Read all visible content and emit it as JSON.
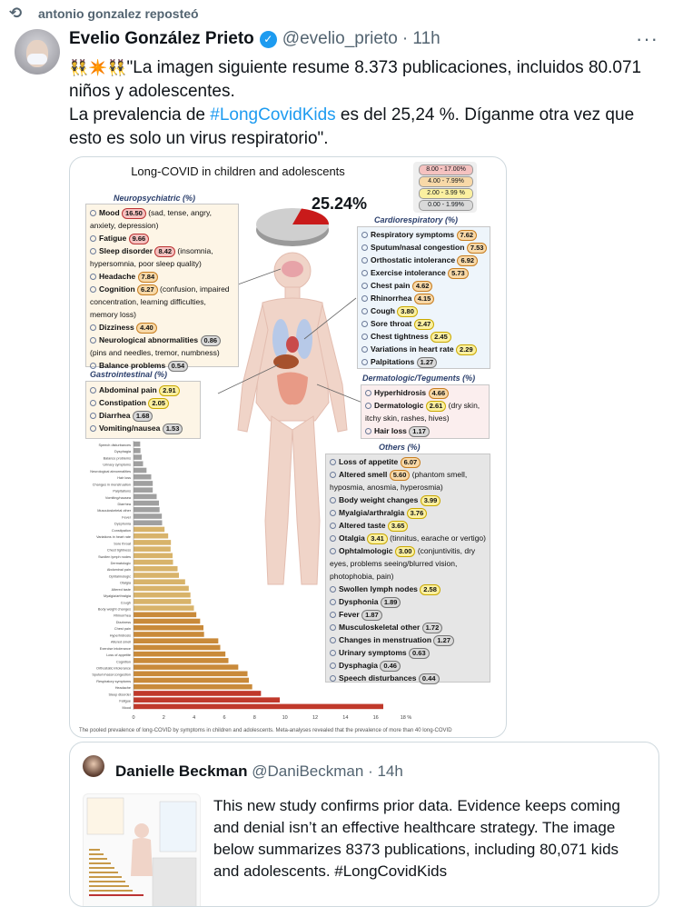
{
  "repost": {
    "text": "antonio gonzalez reposteó",
    "icon": "repost-icon"
  },
  "tweet": {
    "author_name": "Evelio González Prieto",
    "handle": "@evelio_prieto",
    "time": "· 11h",
    "text_quote_open": "\"La imagen siguiente resume 8.373 publicaciones, incluidos 80.071 niños y adolescentes.",
    "text_line2_pre": "La prevalencia de ",
    "hashtag": "#LongCovidKids",
    "text_line2_post": " es del 25,24 %. Díganme otra vez que esto es solo un virus respiratorio\".",
    "emojis": "👯✴️👯"
  },
  "figure": {
    "title": "Long-COVID in children and adolescents",
    "percent": "25.24%",
    "legend": [
      {
        "label": "8.00 - 17.00%",
        "color": "#f5c2c0"
      },
      {
        "label": "4.00 - 7.99%",
        "color": "#f8d9a8"
      },
      {
        "label": "2.00 - 3.99 %",
        "color": "#fbf0a0"
      },
      {
        "label": "0.00 - 1.99%",
        "color": "#d9d9d9"
      }
    ],
    "neuro": {
      "title": "Neuropsychiatric (%)",
      "items": [
        {
          "name": "Mood",
          "value": "16.50",
          "cls": "p-r",
          "note": "(sad, tense, angry,"
        },
        {
          "name": "",
          "value": "",
          "cls": "",
          "note": "anxiety, depression)"
        },
        {
          "name": "Fatigue",
          "value": "9.66",
          "cls": "p-r",
          "note": ""
        },
        {
          "name": "Sleep disorder",
          "value": "8.42",
          "cls": "p-r",
          "note": "(insomnia,"
        },
        {
          "name": "",
          "value": "",
          "cls": "",
          "note": "hypersomnia, poor sleep quality)"
        },
        {
          "name": "Headache",
          "value": "7.84",
          "cls": "p-o",
          "note": ""
        },
        {
          "name": "Cognition",
          "value": "6.27",
          "cls": "p-o",
          "note": "(confusion, impaired"
        },
        {
          "name": "",
          "value": "",
          "cls": "",
          "note": "concentration, learning difficulties,"
        },
        {
          "name": "",
          "value": "",
          "cls": "",
          "note": "memory loss)"
        },
        {
          "name": "Dizziness",
          "value": "4.40",
          "cls": "p-o",
          "note": ""
        },
        {
          "name": "Neurological abnormalities",
          "value": "0.86",
          "cls": "p-g",
          "note": ""
        },
        {
          "name": "",
          "value": "",
          "cls": "",
          "note": "(pins and needles, tremor, numbness)"
        },
        {
          "name": "Balance problems",
          "value": "0.54",
          "cls": "p-g",
          "note": ""
        }
      ]
    },
    "gastro": {
      "title": "Gastrointestinal (%)",
      "items": [
        {
          "name": "Abdominal pain",
          "value": "2.91",
          "cls": "p-y"
        },
        {
          "name": "Constipation",
          "value": "2.05",
          "cls": "p-y"
        },
        {
          "name": "Diarrhea",
          "value": "1.68",
          "cls": "p-g"
        },
        {
          "name": "Vomiting/nausea",
          "value": "1.53",
          "cls": "p-g"
        }
      ]
    },
    "cardio": {
      "title": "Cardiorespiratory (%)",
      "items": [
        {
          "name": "Respiratory symptoms",
          "value": "7.62",
          "cls": "p-o"
        },
        {
          "name": "Sputum/nasal congestion",
          "value": "7.53",
          "cls": "p-o"
        },
        {
          "name": "Orthostatic intolerance",
          "value": "6.92",
          "cls": "p-o"
        },
        {
          "name": "Exercise intolerance",
          "value": "5.73",
          "cls": "p-o"
        },
        {
          "name": "Chest pain",
          "value": "4.62",
          "cls": "p-o"
        },
        {
          "name": "Rhinorrhea",
          "value": "4.15",
          "cls": "p-o"
        },
        {
          "name": "Cough",
          "value": "3.80",
          "cls": "p-y"
        },
        {
          "name": "Sore throat",
          "value": "2.47",
          "cls": "p-y"
        },
        {
          "name": "Chest tightness",
          "value": "2.45",
          "cls": "p-y"
        },
        {
          "name": "Variations in heart rate",
          "value": "2.29",
          "cls": "p-y"
        },
        {
          "name": "Palpitations",
          "value": "1.27",
          "cls": "p-g"
        }
      ]
    },
    "derma": {
      "title": "Dermatologic/Teguments (%)",
      "items": [
        {
          "name": "Hyperhidrosis",
          "value": "4.66",
          "cls": "p-o",
          "note": ""
        },
        {
          "name": "Dermatologic",
          "value": "2.61",
          "cls": "p-y",
          "note": "(dry skin,"
        },
        {
          "name": "",
          "value": "",
          "cls": "",
          "note": "itchy skin, rashes, hives)"
        },
        {
          "name": "Hair loss",
          "value": "1.17",
          "cls": "p-g",
          "note": ""
        }
      ]
    },
    "others": {
      "title": "Others (%)",
      "items": [
        {
          "name": "Loss of appetite",
          "value": "6.07",
          "cls": "p-o",
          "note": ""
        },
        {
          "name": "Altered smell",
          "value": "5.60",
          "cls": "p-o",
          "note": "(phantom smell,"
        },
        {
          "name": "",
          "value": "",
          "cls": "",
          "note": "hyposmia, anosmia, hyperosmia)"
        },
        {
          "name": "Body weight changes",
          "value": "3.99",
          "cls": "p-y",
          "note": ""
        },
        {
          "name": "Myalgia/arthralgia",
          "value": "3.76",
          "cls": "p-y",
          "note": ""
        },
        {
          "name": "Altered taste",
          "value": "3.65",
          "cls": "p-y",
          "note": ""
        },
        {
          "name": "Otalgia",
          "value": "3.41",
          "cls": "p-y",
          "note": "(tinnitus, earache or vertigo)"
        },
        {
          "name": "Ophtalmologic",
          "value": "3.00",
          "cls": "p-y",
          "note": "(conjuntivitis, dry"
        },
        {
          "name": "",
          "value": "",
          "cls": "",
          "note": "eyes, problems seeing/blurred vision,"
        },
        {
          "name": "",
          "value": "",
          "cls": "",
          "note": "photophobia, pain)"
        },
        {
          "name": "Swollen lymph nodes",
          "value": "2.58",
          "cls": "p-y",
          "note": ""
        },
        {
          "name": "Dysphonia",
          "value": "1.89",
          "cls": "p-g",
          "note": ""
        },
        {
          "name": "Fever",
          "value": "1.87",
          "cls": "p-g",
          "note": ""
        },
        {
          "name": "Musculoskeletal other",
          "value": "1.72",
          "cls": "p-g",
          "note": ""
        },
        {
          "name": "Changes in menstruation",
          "value": "1.27",
          "cls": "p-g",
          "note": ""
        },
        {
          "name": "Urinary symptoms",
          "value": "0.63",
          "cls": "p-g",
          "note": ""
        },
        {
          "name": "Dysphagia",
          "value": "0.46",
          "cls": "p-g",
          "note": ""
        },
        {
          "name": "Speech disturbances",
          "value": "0.44",
          "cls": "p-g",
          "note": ""
        }
      ]
    },
    "caption": "The pooled prevalence of long-COVID by symptoms in children and adolescents. Meta-analyses revealed that the prevalence of more than 40 long-COVID"
  },
  "chart_data": {
    "type": "bar",
    "orientation": "horizontal",
    "categories": [
      "Speech disturbances",
      "Dysphagia",
      "Balance problems",
      "Urinary symptoms",
      "Neurological abnormalities",
      "Hair loss",
      "Changes in menstruation",
      "Palpitations",
      "Vomiting/nausea",
      "Diarrhea",
      "Musculoskeletal other",
      "Fever",
      "Dysphonia",
      "Constipation",
      "Variations in heart rate",
      "Sore throat",
      "Chest tightness",
      "Swollen lymph nodes",
      "Dermatologic",
      "Abdominal pain",
      "Ophtalmologic",
      "Otalgia",
      "Altered taste",
      "Myalgia/arthralgia",
      "Cough",
      "Body weight changes",
      "Rhinorrhea",
      "Dizziness",
      "Chest pain",
      "Hyperhidrosis",
      "Altered smell",
      "Exercise intolerance",
      "Loss of appetite",
      "Cognition",
      "Orthostatic intolerance",
      "Sputum/nasal congestion",
      "Respiratory symptoms",
      "Headache",
      "Sleep disorder",
      "Fatigue",
      "Mood"
    ],
    "values": [
      0.44,
      0.46,
      0.54,
      0.63,
      0.86,
      1.17,
      1.27,
      1.27,
      1.53,
      1.68,
      1.72,
      1.87,
      1.89,
      2.05,
      2.29,
      2.47,
      2.45,
      2.58,
      2.61,
      2.91,
      3.0,
      3.41,
      3.65,
      3.76,
      3.8,
      3.99,
      4.15,
      4.4,
      4.62,
      4.66,
      5.6,
      5.73,
      6.07,
      6.27,
      6.92,
      7.53,
      7.62,
      7.84,
      8.42,
      9.66,
      16.5
    ],
    "xticks": [
      "0",
      "2",
      "4",
      "6",
      "8",
      "10",
      "12",
      "14",
      "16",
      "18 %"
    ],
    "xlim": [
      0,
      18
    ]
  },
  "quote": {
    "author_name": "Danielle Beckman",
    "handle": "@DaniBeckman",
    "time": "· 14h",
    "text": "This new study confirms prior data. Evidence keeps coming and denial isn’t an effective healthcare strategy. The image below summarizes 8373 publications, including 80,071 kids and adolescents. #LongCovidKids"
  },
  "menu": {
    "more": "···"
  }
}
